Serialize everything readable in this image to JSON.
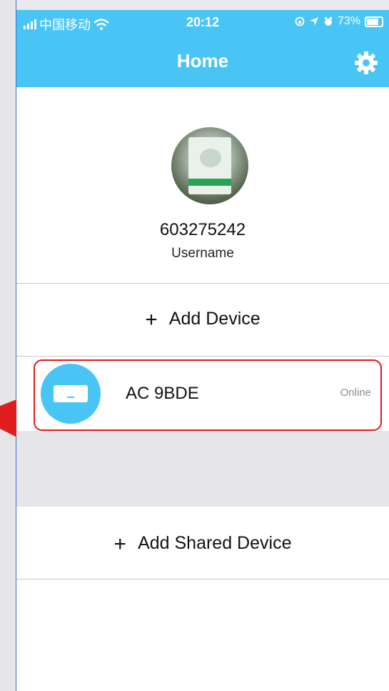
{
  "status_bar": {
    "carrier": "中国移动",
    "time": "20:12",
    "battery": "73%"
  },
  "header": {
    "title": "Home",
    "settings_icon": "gear-icon"
  },
  "profile": {
    "user_id": "603275242",
    "label": "Username"
  },
  "actions": {
    "add_device": "Add Device",
    "add_shared_device": "Add Shared Device"
  },
  "devices": [
    {
      "name": "AC 9BDE",
      "status": "Online",
      "icon": "air-conditioner-icon"
    }
  ],
  "colors": {
    "accent": "#49c5f5",
    "highlight": "#e21a1a"
  }
}
